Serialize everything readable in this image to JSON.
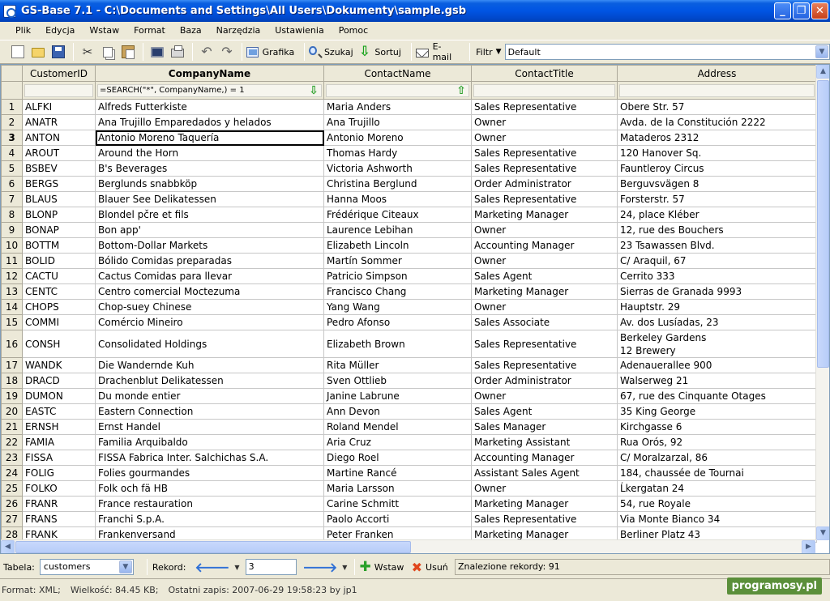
{
  "window": {
    "title": "GS-Base 7.1 - C:\\Documents and Settings\\All Users\\Dokumenty\\sample.gsb"
  },
  "menu": [
    "Plik",
    "Edycja",
    "Wstaw",
    "Format",
    "Baza",
    "Narzędzia",
    "Ustawienia",
    "Pomoc"
  ],
  "toolbar": {
    "grafika": "Grafika",
    "szukaj": "Szukaj",
    "sortuj": "Sortuj",
    "email": "E-mail",
    "filtr_label": "Filtr",
    "filtr_value": "Default"
  },
  "grid": {
    "columns": [
      "CustomerID",
      "CompanyName",
      "ContactName",
      "ContactTitle",
      "Address"
    ],
    "sorted_column": "CompanyName",
    "filters": [
      "",
      "=SEARCH(\"*\", CompanyName,) = 1",
      "",
      "",
      ""
    ],
    "current_row": 3,
    "rows": [
      [
        "1",
        "ALFKI",
        "Alfreds Futterkiste",
        "Maria Anders",
        "Sales Representative",
        "Obere Str. 57"
      ],
      [
        "2",
        "ANATR",
        "Ana Trujillo Emparedados y helados",
        "Ana Trujillo",
        "Owner",
        "Avda. de la Constitución 2222"
      ],
      [
        "3",
        "ANTON",
        "Antonio Moreno Taquería",
        "Antonio Moreno",
        "Owner",
        "Mataderos 2312"
      ],
      [
        "4",
        "AROUT",
        "Around the Horn",
        "Thomas Hardy",
        "Sales Representative",
        "120 Hanover Sq."
      ],
      [
        "5",
        "BSBEV",
        "B's Beverages",
        "Victoria Ashworth",
        "Sales Representative",
        "Fauntleroy Circus"
      ],
      [
        "6",
        "BERGS",
        "Berglunds snabbköp",
        "Christina Berglund",
        "Order Administrator",
        "Berguvsvägen 8"
      ],
      [
        "7",
        "BLAUS",
        "Blauer See Delikatessen",
        "Hanna Moos",
        "Sales Representative",
        "Forsterstr. 57"
      ],
      [
        "8",
        "BLONP",
        "Blondel pčre et fils",
        "Frédérique Citeaux",
        "Marketing Manager",
        "24, place Kléber"
      ],
      [
        "9",
        "BONAP",
        "Bon app'",
        "Laurence Lebihan",
        "Owner",
        "12, rue des Bouchers"
      ],
      [
        "10",
        "BOTTM",
        "Bottom-Dollar Markets",
        "Elizabeth Lincoln",
        "Accounting Manager",
        "23 Tsawassen Blvd."
      ],
      [
        "11",
        "BOLID",
        "Bólido Comidas preparadas",
        "Martín Sommer",
        "Owner",
        "C/ Araquil, 67"
      ],
      [
        "12",
        "CACTU",
        "Cactus Comidas para llevar",
        "Patricio Simpson",
        "Sales Agent",
        "Cerrito 333"
      ],
      [
        "13",
        "CENTC",
        "Centro comercial Moctezuma",
        "Francisco Chang",
        "Marketing Manager",
        "Sierras de Granada 9993"
      ],
      [
        "14",
        "CHOPS",
        "Chop-suey Chinese",
        "Yang Wang",
        "Owner",
        "Hauptstr. 29"
      ],
      [
        "15",
        "COMMI",
        "Comércio Mineiro",
        "Pedro Afonso",
        "Sales Associate",
        "Av. dos Lusíadas, 23"
      ],
      [
        "16",
        "CONSH",
        "Consolidated Holdings",
        "Elizabeth Brown",
        "Sales Representative",
        "Berkeley Gardens",
        "12 Brewery"
      ],
      [
        "17",
        "WANDK",
        "Die Wandernde Kuh",
        "Rita Müller",
        "Sales Representative",
        "Adenauerallee 900"
      ],
      [
        "18",
        "DRACD",
        "Drachenblut Delikatessen",
        "Sven Ottlieb",
        "Order Administrator",
        "Walserweg 21"
      ],
      [
        "19",
        "DUMON",
        "Du monde entier",
        "Janine Labrune",
        "Owner",
        "67, rue des Cinquante Otages"
      ],
      [
        "20",
        "EASTC",
        "Eastern Connection",
        "Ann Devon",
        "Sales Agent",
        "35 King George"
      ],
      [
        "21",
        "ERNSH",
        "Ernst Handel",
        "Roland Mendel",
        "Sales Manager",
        "Kirchgasse 6"
      ],
      [
        "22",
        "FAMIA",
        "Familia Arquibaldo",
        "Aria Cruz",
        "Marketing Assistant",
        "Rua Orós, 92"
      ],
      [
        "23",
        "FISSA",
        "FISSA Fabrica Inter. Salchichas S.A.",
        "Diego Roel",
        "Accounting Manager",
        "C/ Moralzarzal, 86"
      ],
      [
        "24",
        "FOLIG",
        "Folies gourmandes",
        "Martine Rancé",
        "Assistant Sales Agent",
        "184, chaussée de Tournai"
      ],
      [
        "25",
        "FOLKO",
        "Folk och fä HB",
        "Maria Larsson",
        "Owner",
        "Ĺkergatan 24"
      ],
      [
        "26",
        "FRANR",
        "France restauration",
        "Carine Schmitt",
        "Marketing Manager",
        "54, rue Royale"
      ],
      [
        "27",
        "FRANS",
        "Franchi S.p.A.",
        "Paolo Accorti",
        "Sales Representative",
        "Via Monte Bianco 34"
      ],
      [
        "28",
        "FRANK",
        "Frankenversand",
        "Peter Franken",
        "Marketing Manager",
        "Berliner Platz 43"
      ]
    ]
  },
  "navbar": {
    "tabela_label": "Tabela:",
    "tabela_value": "customers",
    "rekord_label": "Rekord:",
    "rekord_value": "3",
    "wstaw": "Wstaw",
    "usun": "Usuń",
    "found": "Znalezione rekordy:  91"
  },
  "status": {
    "format": "Format: XML;",
    "size": "Wielkość: 84.45 KB;",
    "last_save": "Ostatni zapis: 2007-06-29 19:58:23 by jp1"
  },
  "watermark": "programosy.pl"
}
